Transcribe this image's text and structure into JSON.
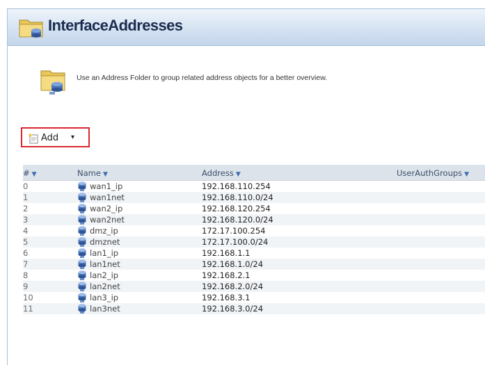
{
  "header": {
    "title": "InterfaceAddresses",
    "folder_icon": "address-folder-icon"
  },
  "info": {
    "text": "Use an Address Folder to group related address objects for a better overview.",
    "icon": "address-folder-icon"
  },
  "toolbar": {
    "add_label": "Add",
    "add_caret": "▾"
  },
  "table": {
    "columns": [
      {
        "label": "#"
      },
      {
        "label": "Name"
      },
      {
        "label": "Address"
      },
      {
        "label": "UserAuthGroups"
      }
    ],
    "rows": [
      {
        "num": "0",
        "name": "wan1_ip",
        "address": "192.168.110.254"
      },
      {
        "num": "1",
        "name": "wan1net",
        "address": "192.168.110.0/24"
      },
      {
        "num": "2",
        "name": "wan2_ip",
        "address": "192.168.120.254"
      },
      {
        "num": "3",
        "name": "wan2net",
        "address": "192.168.120.0/24"
      },
      {
        "num": "4",
        "name": "dmz_ip",
        "address": "172.17.100.254"
      },
      {
        "num": "5",
        "name": "dmznet",
        "address": "172.17.100.0/24"
      },
      {
        "num": "6",
        "name": "lan1_ip",
        "address": "192.168.1.1"
      },
      {
        "num": "7",
        "name": "lan1net",
        "address": "192.168.1.0/24"
      },
      {
        "num": "8",
        "name": "lan2_ip",
        "address": "192.168.2.1"
      },
      {
        "num": "9",
        "name": "lan2net",
        "address": "192.168.2.0/24"
      },
      {
        "num": "10",
        "name": "lan3_ip",
        "address": "192.168.3.1"
      },
      {
        "num": "11",
        "name": "lan3net",
        "address": "192.168.3.0/24"
      }
    ]
  },
  "colors": {
    "accent_red": "#d9272e",
    "header_blue": "#1b2c4e",
    "sort_caret": "#3f6fb0"
  }
}
